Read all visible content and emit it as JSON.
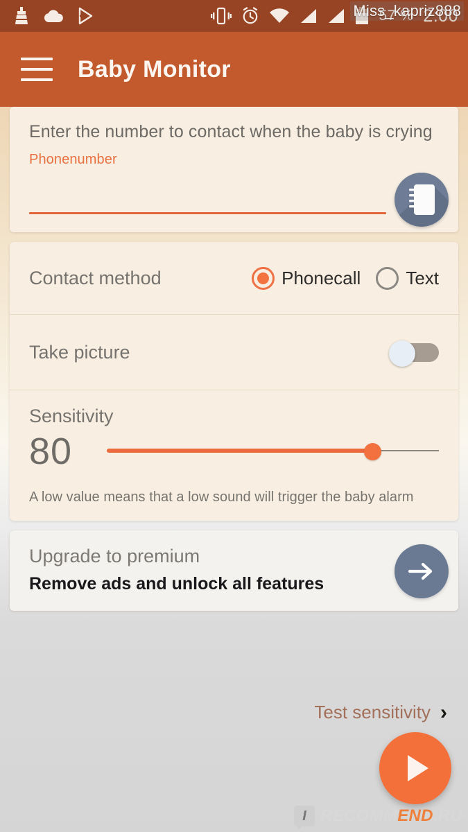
{
  "status_bar": {
    "icons_left": [
      "cleaner-icon",
      "cloud-icon",
      "play-store-icon"
    ],
    "icons_right": [
      "vibrate-icon",
      "alarm-icon",
      "wifi-icon",
      "signal-1-icon",
      "signal-2-icon",
      "battery-icon"
    ],
    "battery": "57 %",
    "clock": "2:00"
  },
  "watermark_top": "Miss_kapriz888",
  "appbar": {
    "menu_icon": "hamburger-menu-icon",
    "title": "Baby Monitor"
  },
  "phone_card": {
    "title": "Enter the number to contact when the baby is crying",
    "field_label": "Phonenumber",
    "field_value": "",
    "field_placeholder": "",
    "contacts_icon": "contacts-book-icon"
  },
  "contact_method": {
    "label": "Contact method",
    "options": [
      {
        "label": "Phonecall",
        "selected": true
      },
      {
        "label": "Text",
        "selected": false
      }
    ]
  },
  "take_picture": {
    "label": "Take picture",
    "enabled": false
  },
  "sensitivity": {
    "label": "Sensitivity",
    "value": "80",
    "value_percent": 80,
    "help": "A low value means that a low sound will trigger the baby alarm"
  },
  "premium": {
    "title": "Upgrade to premium",
    "subtitle": "Remove ads and unlock all features",
    "arrow_icon": "arrow-right-icon"
  },
  "test_link": {
    "label": "Test sensitivity",
    "chevron": "›"
  },
  "fab": {
    "icon": "play-icon"
  },
  "watermark_bottom": {
    "badge": "I",
    "text_grey": "RECOMM",
    "text_orange": "END",
    "text_grey2": ".RU"
  },
  "colors": {
    "status_bar": "#974424",
    "app_bar": "#c25a2d",
    "accent": "#f2713f",
    "card": "#f8efe2",
    "icon_circle": "#6e7c95"
  }
}
